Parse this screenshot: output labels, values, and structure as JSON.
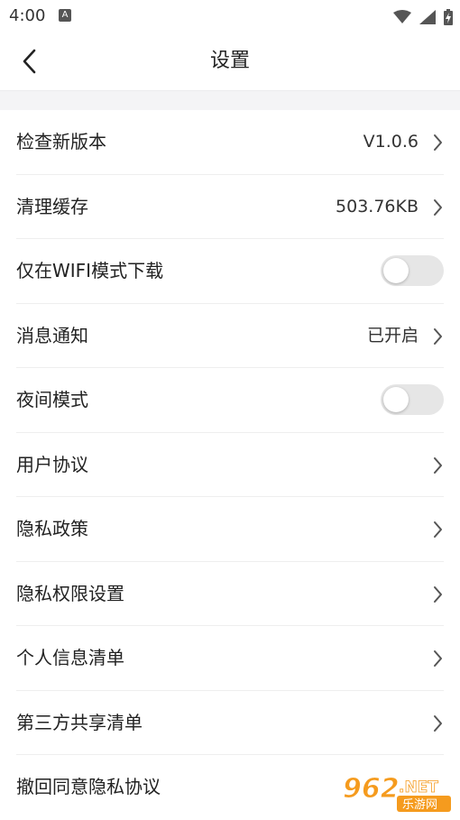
{
  "status": {
    "time": "4:00",
    "notif_glyph": "A"
  },
  "header": {
    "title": "设置"
  },
  "settings": {
    "items": [
      {
        "label": "检查新版本",
        "value": "V1.0.6"
      },
      {
        "label": "清理缓存",
        "value": "503.76KB"
      },
      {
        "label": "仅在WIFI模式下载",
        "toggle": false
      },
      {
        "label": "消息通知",
        "value": "已开启"
      },
      {
        "label": "夜间模式",
        "toggle": false
      },
      {
        "label": "用户协议"
      },
      {
        "label": "隐私政策"
      },
      {
        "label": "隐私权限设置"
      },
      {
        "label": "个人信息清单"
      },
      {
        "label": "第三方共享清单"
      },
      {
        "label": "撤回同意隐私协议"
      }
    ]
  },
  "watermark": {
    "brand": "962",
    "suffix": ".NET",
    "tagline": "乐游网"
  },
  "colors": {
    "toggle_off": "#e6e6e6",
    "divider": "#f4f4f6",
    "watermark_orange": "#f59b1e"
  }
}
